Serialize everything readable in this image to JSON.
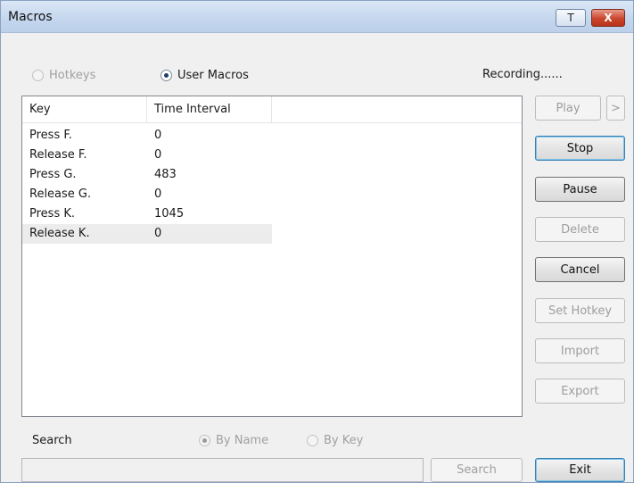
{
  "window": {
    "title": "Macros",
    "minimize_glyph": "T",
    "close_glyph": "X"
  },
  "mode": {
    "hotkeys_label": "Hotkeys",
    "hotkeys_selected": false,
    "hotkeys_enabled": false,
    "user_macros_label": "User Macros",
    "user_macros_selected": true,
    "user_macros_enabled": true
  },
  "status_text": "Recording......",
  "list": {
    "columns": [
      "Key",
      "Time Interval"
    ],
    "rows": [
      {
        "key": "Press F.",
        "interval": "0"
      },
      {
        "key": "Release F.",
        "interval": "0"
      },
      {
        "key": "Press G.",
        "interval": "483"
      },
      {
        "key": "Release G.",
        "interval": "0"
      },
      {
        "key": "Press K.",
        "interval": "1045"
      },
      {
        "key": "Release K.",
        "interval": "0"
      }
    ],
    "selected_row_index": 5
  },
  "buttons": {
    "play": "Play",
    "play_more": ">",
    "stop": "Stop",
    "pause": "Pause",
    "delete": "Delete",
    "cancel": "Cancel",
    "set_hotkey": "Set Hotkey",
    "import": "Import",
    "export": "Export",
    "exit": "Exit"
  },
  "search": {
    "label": "Search",
    "by_name_label": "By Name",
    "by_key_label": "By Key",
    "by_name_selected": true,
    "input_value": "",
    "button_label": "Search"
  },
  "colors": {
    "title_bar": "#c4d6ee",
    "close_button": "#c9452d",
    "default_button_border": "#3c7fb1",
    "selected_row": "#ececec"
  }
}
